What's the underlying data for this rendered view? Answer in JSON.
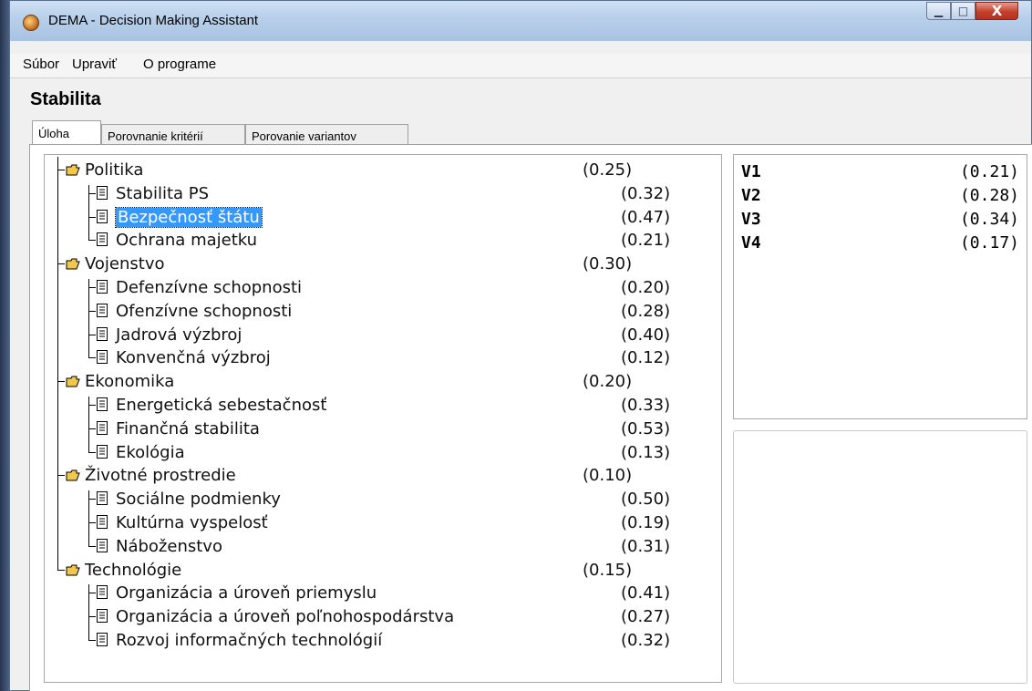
{
  "window": {
    "title": "DEMA - Decision Making Assistant",
    "minimize_glyph": "▁",
    "maximize_glyph": "□",
    "close_glyph": "X"
  },
  "menu": [
    "Súbor",
    "Upraviť",
    "O programe"
  ],
  "heading": "Stabilita",
  "tabs": [
    "Úloha",
    "Porovnanie kritérií",
    "Porovanie variantov"
  ],
  "tree": [
    {
      "label": "Politika",
      "value": "(0.25)",
      "children": [
        {
          "label": "Stabilita PS",
          "value": "(0.32)"
        },
        {
          "label": "Bezpečnosť štátu",
          "value": "(0.47)",
          "selected": true
        },
        {
          "label": "Ochrana majetku",
          "value": "(0.21)"
        }
      ]
    },
    {
      "label": "Vojenstvo",
      "value": "(0.30)",
      "children": [
        {
          "label": "Defenzívne schopnosti",
          "value": "(0.20)"
        },
        {
          "label": "Ofenzívne schopnosti",
          "value": "(0.28)"
        },
        {
          "label": "Jadrová výzbroj",
          "value": "(0.40)"
        },
        {
          "label": "Konvenčná výzbroj",
          "value": "(0.12)"
        }
      ]
    },
    {
      "label": "Ekonomika",
      "value": "(0.20)",
      "children": [
        {
          "label": "Energetická sebestačnosť",
          "value": "(0.33)"
        },
        {
          "label": "Finančná stabilita",
          "value": "(0.53)"
        },
        {
          "label": "Ekológia",
          "value": "(0.13)"
        }
      ]
    },
    {
      "label": "Životné prostredie",
      "value": "(0.10)",
      "children": [
        {
          "label": "Sociálne podmienky",
          "value": "(0.50)"
        },
        {
          "label": "Kultúrna vyspelosť",
          "value": "(0.19)"
        },
        {
          "label": "Náboženstvo",
          "value": "(0.31)"
        }
      ]
    },
    {
      "label": "Technológie",
      "value": "(0.15)",
      "children": [
        {
          "label": "Organizácia a úroveň priemyslu",
          "value": "(0.41)"
        },
        {
          "label": "Organizácia a úroveň poľnohospodárstva",
          "value": "(0.27)"
        },
        {
          "label": "Rozvoj informačných technológií",
          "value": "(0.32)"
        }
      ]
    }
  ],
  "results": [
    {
      "name": "V1",
      "value": "(0.21)"
    },
    {
      "name": "V2",
      "value": "(0.28)"
    },
    {
      "name": "V3",
      "value": "(0.34)"
    },
    {
      "name": "V4",
      "value": "(0.17)"
    }
  ],
  "colors": {
    "selection": "#3399ff",
    "folder": "#f2c84b"
  },
  "icons": {
    "folder": "folder-open-icon",
    "document": "document-icon",
    "app": "app-icon"
  }
}
